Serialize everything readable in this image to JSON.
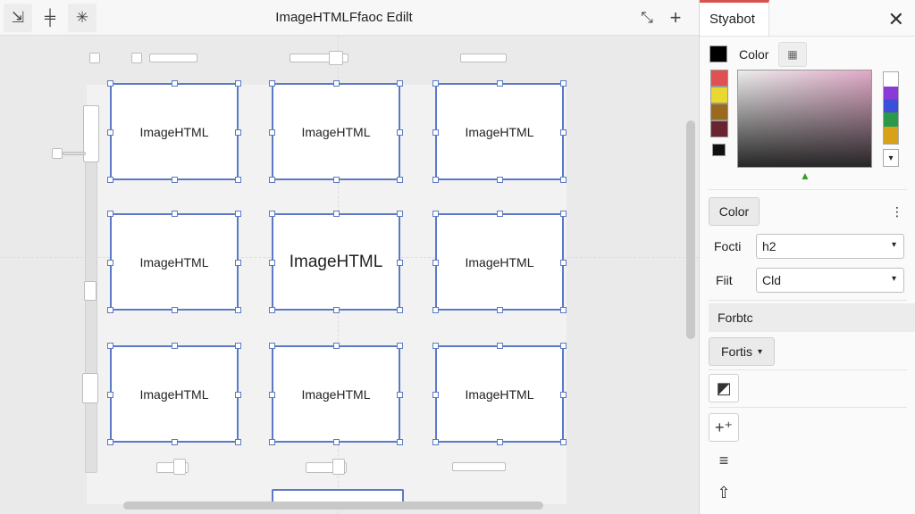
{
  "window": {
    "title": "ImageHTMLFfaoc Edilt"
  },
  "toolbar": {
    "left_icons": [
      "collapse-icon",
      "align-icon",
      "asterisk-icon"
    ],
    "left_glyphs": [
      "⇲",
      "╪",
      "✳"
    ],
    "right_icons": [
      "shrink-icon",
      "plus-icon"
    ],
    "right_glyphs": [
      "⤡",
      "+"
    ]
  },
  "canvas": {
    "frames": [
      {
        "label": "ImageHTML"
      },
      {
        "label": "ImageHTML"
      },
      {
        "label": "ImageHTML"
      },
      {
        "label": "ImageHTML"
      },
      {
        "label": "ImageHTML"
      },
      {
        "label": "ImageHTML"
      },
      {
        "label": "ImageHTML"
      },
      {
        "label": "ImageHTML"
      },
      {
        "label": "ImageHTML"
      }
    ],
    "selected_frame": 4
  },
  "panel": {
    "tab_label": "Styabot",
    "close_glyph": "✕",
    "color_label": "Color",
    "current_color": "#000000",
    "swatches": [
      "#e05252",
      "#e8d830",
      "#9a6a1e",
      "#6a2430",
      "#111111"
    ],
    "hue_caret": "▾",
    "color_button": "Color",
    "more_glyph": "⋮",
    "font_label": "Focti",
    "font_value": "h2",
    "fill_label": "Fiit",
    "fill_value": "Cld",
    "fonts_button": "Forbtc",
    "fonts_dropdown": "Fortis",
    "dropdown_caret": "▾",
    "tools": [
      {
        "icon": "frame-icon",
        "glyph": "◩"
      },
      {
        "icon": "add-icon",
        "glyph": "+⁺"
      },
      {
        "icon": "menu-icon",
        "glyph": "≡"
      },
      {
        "icon": "arrow-up-icon",
        "glyph": "⇧"
      }
    ]
  }
}
